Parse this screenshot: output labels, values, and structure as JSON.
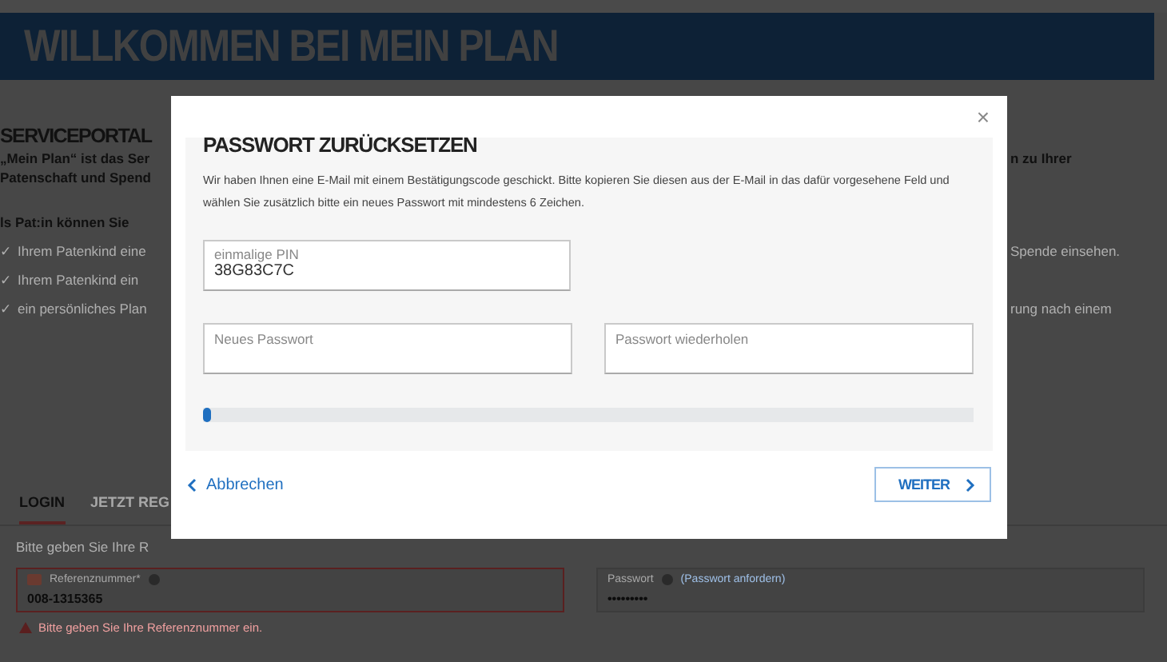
{
  "header": {
    "title": "WILLKOMMEN BEI MEIN PLAN"
  },
  "intro_rows": [
    {
      "kind": "heading",
      "left": "SERVICEPORTAL"
    },
    {
      "kind": "bold",
      "left": "„Mein Plan“ ist das Ser",
      "right": "n zu Ihrer"
    },
    {
      "kind": "bold",
      "left": "Patenschaft und Spend"
    },
    {
      "kind": "sub",
      "left": "ls Pat:in können Sie"
    },
    {
      "kind": "bullet",
      "mark": "✓",
      "left": "Ihrem Patenkind eine",
      "right": "Spende einsehen."
    },
    {
      "kind": "bullet",
      "mark": "✓",
      "left": "Ihrem Patenkind ein"
    },
    {
      "kind": "bullet",
      "mark": "✓",
      "left": "ein persönliches Plan",
      "right": "rung nach einem"
    }
  ],
  "tabs": [
    {
      "label": "LOGIN",
      "selected": true
    },
    {
      "label": "JETZT REG",
      "selected": false
    }
  ],
  "login_prompt": "Bitte geben Sie Ihre R",
  "login_fields": [
    {
      "label": "Referenznummer*",
      "value": "008-1315365",
      "error": true
    },
    {
      "label": "Passwort",
      "link": "(Passwort anfordern)",
      "value": "•••••••••",
      "error": false
    }
  ],
  "error_message": "Bitte geben Sie Ihre Referenznummer ein.",
  "modal": {
    "title": "PASSWORT ZURÜCKSETZEN",
    "close": "×",
    "message": "Wir haben Ihnen eine E-Mail mit einem Bestätigungscode geschickt. Bitte kopieren Sie diesen aus der E-Mail in das dafür vorgesehene Feld und wählen Sie zusätzlich bitte ein neues Passwort mit mindestens 6 Zeichen.",
    "pin": {
      "label": "einmalige PIN",
      "value": "38G83C7C"
    },
    "password_fields": [
      {
        "placeholder": "Neues Passwort"
      },
      {
        "placeholder": "Passwort wiederholen"
      }
    ],
    "progress": {
      "level": 0.01
    },
    "cancel": "Abbrechen",
    "next": "WEITER"
  }
}
